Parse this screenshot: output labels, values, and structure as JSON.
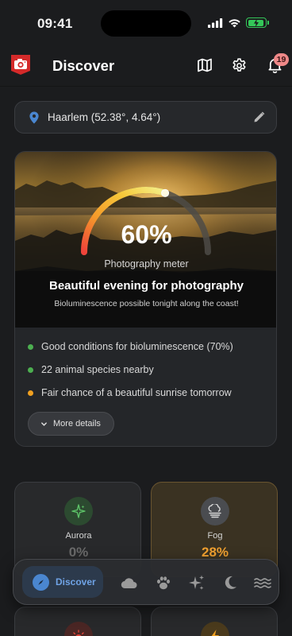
{
  "status_bar": {
    "time": "09:41"
  },
  "header": {
    "title": "Discover",
    "icons": [
      "camera-logo-icon",
      "map-icon",
      "gear-icon",
      "bell-icon"
    ],
    "notification_count": "19"
  },
  "location": {
    "text": "Haarlem (52.38°, 4.64°)",
    "icons": [
      "location-pin-icon",
      "pencil-icon"
    ]
  },
  "meter": {
    "value_text": "60%",
    "value_fraction": 0.6,
    "label": "Photography meter",
    "title": "Beautiful evening for photography",
    "subtitle": "Bioluminescence possible tonight along the coast!"
  },
  "conditions": [
    {
      "text": "Good conditions for bioluminescence (70%)",
      "color": "#4caf50"
    },
    {
      "text": "22 animal species nearby",
      "color": "#4caf50"
    },
    {
      "text": "Fair chance of a beautiful sunrise tomorrow",
      "color": "#f0a020"
    }
  ],
  "more_details": {
    "label": "More details"
  },
  "phenomena": [
    {
      "name": "Aurora",
      "value": "0%",
      "icon": "sparkle-icon",
      "accent": "#4caf50"
    },
    {
      "name": "Fog",
      "value": "28%",
      "icon": "fog-icon",
      "accent": "#f0a030"
    }
  ],
  "bottom_nav": {
    "active_label": "Discover",
    "items": [
      "compass-icon",
      "cloud-icon",
      "paw-icon",
      "sparkles-icon",
      "moon-icon",
      "waves-icon"
    ]
  },
  "colors": {
    "background": "#1b1c1e",
    "accent_blue": "#4a86cf",
    "battery": "#34c759"
  }
}
